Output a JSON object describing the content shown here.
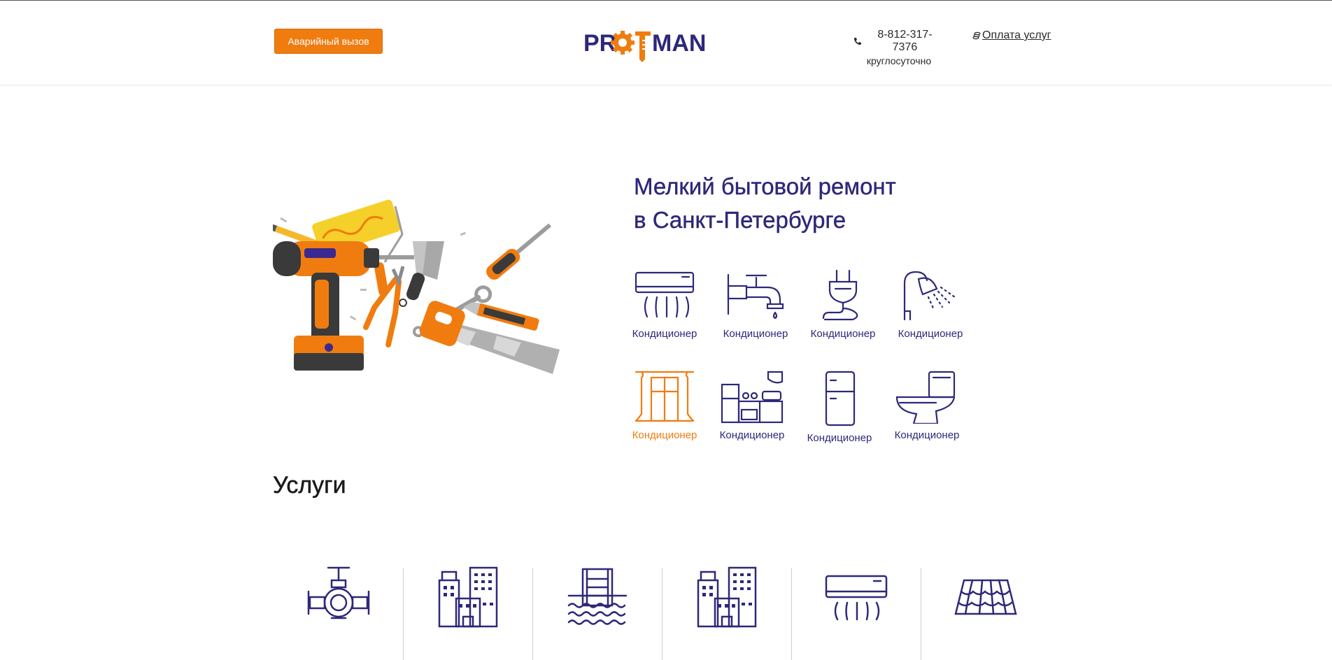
{
  "header": {
    "emergency_button": "Аварийный вызов",
    "logo": {
      "text": "PROFMAN",
      "brand_blue": "#2d2879",
      "brand_orange": "#f07c10"
    },
    "phone": "8-812-317-7376",
    "phone_note": "круглосуточно",
    "payment_link": "Оплата услуг"
  },
  "hero": {
    "title_line1": "Мелкий бытовой ремонт",
    "title_line2": "в Санкт-Петербурге",
    "illustration": "tools-illustration"
  },
  "services": [
    {
      "icon": "air-conditioner-icon",
      "label": "Кондиционер",
      "active": false
    },
    {
      "icon": "faucet-icon",
      "label": "Кондиционер",
      "active": false
    },
    {
      "icon": "electric-plug-icon",
      "label": "Кондиционер",
      "active": false
    },
    {
      "icon": "shower-icon",
      "label": "Кондиционер",
      "active": false
    },
    {
      "icon": "window-icon",
      "label": "Кондиционер",
      "active": true
    },
    {
      "icon": "kitchen-icon",
      "label": "Кондиционер",
      "active": false
    },
    {
      "icon": "refrigerator-icon",
      "label": "Кондиционер",
      "active": false
    },
    {
      "icon": "toilet-icon",
      "label": "Кондиционер",
      "active": false
    }
  ],
  "services_section": {
    "title": "Услуги",
    "categories": [
      {
        "icon": "valve-icon"
      },
      {
        "icon": "buildings-icon"
      },
      {
        "icon": "pool-ladder-icon"
      },
      {
        "icon": "buildings-icon"
      },
      {
        "icon": "air-conditioner-icon"
      },
      {
        "icon": "roof-tiles-icon"
      }
    ]
  },
  "colors": {
    "accent": "#f07c10",
    "primary": "#2d2879",
    "divider": "#cfcfcf"
  }
}
